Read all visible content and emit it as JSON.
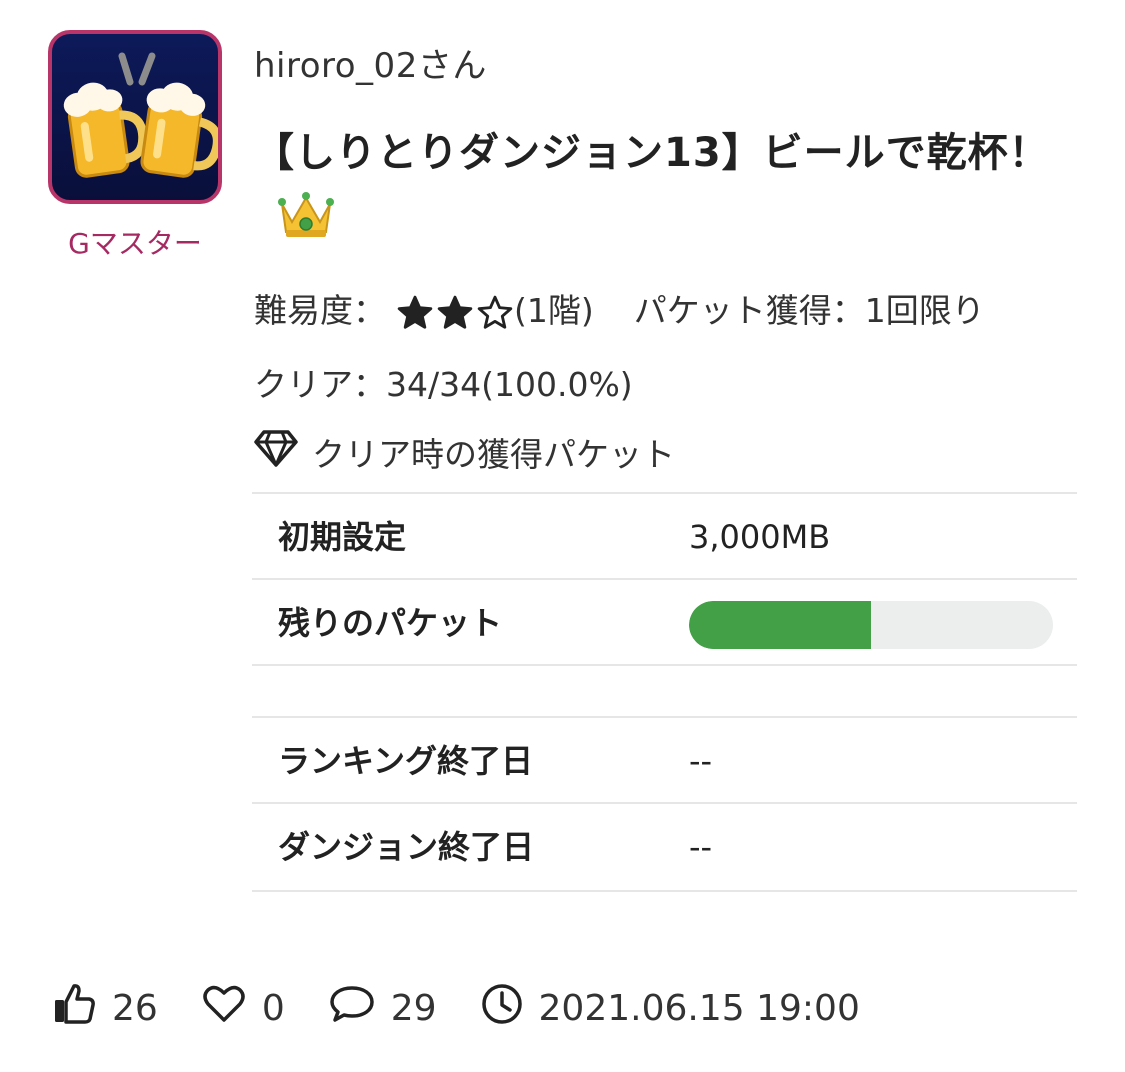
{
  "author": {
    "name": "hiroro_02さん",
    "badge": "Gマスター"
  },
  "dungeon": {
    "title": "【しりとりダンジョン13】ビールで乾杯！",
    "difficulty_label": "難易度：",
    "difficulty_stars": 2,
    "difficulty_max": 3,
    "floors": "(1階)",
    "packet_rule": "パケット獲得：1回限り",
    "clear": "クリア：34/34(100.0%)"
  },
  "packet": {
    "heading": "クリア時の獲得パケット",
    "initial_label": "初期設定",
    "initial_value": "3,000MB",
    "remaining_label": "残りのパケット",
    "remaining_fraction": 0.5
  },
  "dates": {
    "ranking_end_label": "ランキング終了日",
    "ranking_end_value": "--",
    "dungeon_end_label": "ダンジョン終了日",
    "dungeon_end_value": "--"
  },
  "stats": {
    "likes": "26",
    "favorites": "0",
    "comments": "29",
    "datetime": "2021.06.15 19:00"
  },
  "colors": {
    "accent": "#b83569",
    "progress": "#43a047"
  }
}
